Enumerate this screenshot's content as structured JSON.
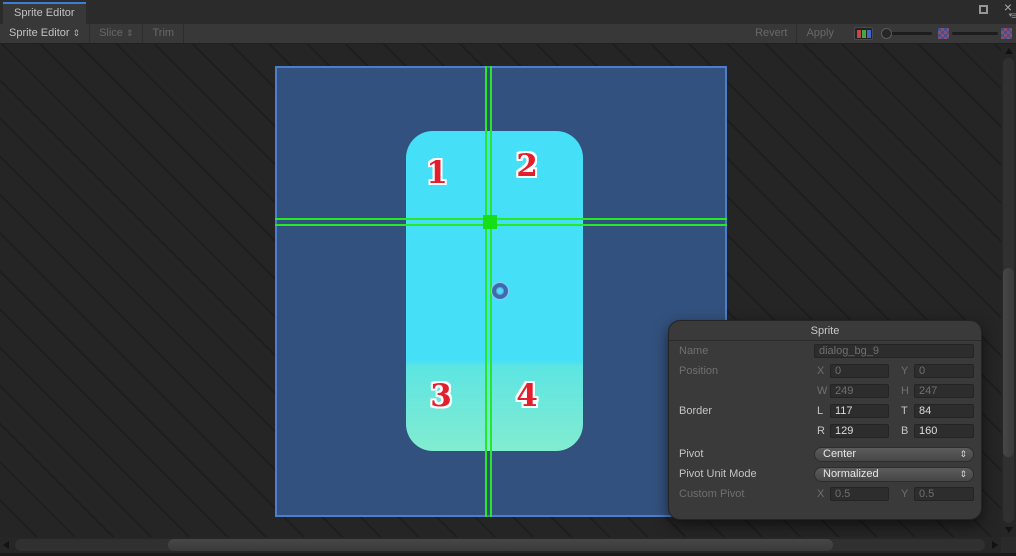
{
  "window": {
    "tab": "Sprite Editor",
    "close_icon": "×",
    "menu_caret": "▾",
    "menu_icon": "≡"
  },
  "toolbar": {
    "sprite_editor": "Sprite Editor",
    "slice": "Slice",
    "trim": "Trim",
    "revert": "Revert",
    "apply": "Apply",
    "dropdown_caret": "⇕"
  },
  "canvas": {
    "quadrant_labels": [
      "1",
      "2",
      "3",
      "4"
    ]
  },
  "panel": {
    "title": "Sprite",
    "dropdown_caret": "⇕",
    "name_label": "Name",
    "name_value": "dialog_bg_9",
    "position_label": "Position",
    "x_label": "X",
    "x_value": "0",
    "y_label": "Y",
    "y_value": "0",
    "w_label": "W",
    "w_value": "249",
    "h_label": "H",
    "h_value": "247",
    "border_label": "Border",
    "l_label": "L",
    "l_value": "117",
    "t_label": "T",
    "t_value": "84",
    "r_label": "R",
    "r_value": "129",
    "b_label": "B",
    "b_value": "160",
    "pivot_label": "Pivot",
    "pivot_value": "Center",
    "pivot_unit_mode_label": "Pivot Unit Mode",
    "pivot_unit_mode_value": "Normalized",
    "custom_pivot_label": "Custom Pivot",
    "cpx_label": "X",
    "cpx_value": "0.5",
    "cpy_label": "Y",
    "cpy_value": "0.5"
  },
  "colors": {
    "accent_blue": "#3d7dd6",
    "texture_background": "#33517e",
    "texture_outline": "#4c7ecd",
    "sprite_top": "#46dff8",
    "sprite_bottom": "#82ecd0",
    "guide_green": "#27e827",
    "number_red": "#e31e2d"
  }
}
